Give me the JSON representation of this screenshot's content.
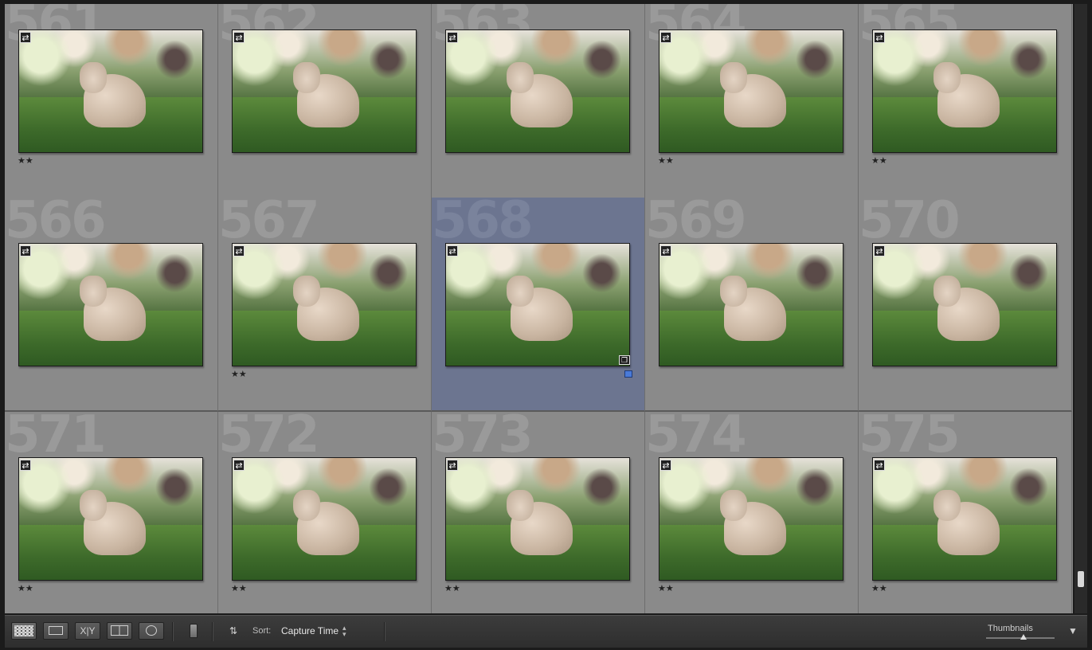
{
  "grid": {
    "cells": [
      {
        "index": "561",
        "rating": "★★",
        "selected": false
      },
      {
        "index": "562",
        "rating": "",
        "selected": false
      },
      {
        "index": "563",
        "rating": "",
        "selected": false
      },
      {
        "index": "564",
        "rating": "★★",
        "selected": false
      },
      {
        "index": "565",
        "rating": "★★",
        "selected": false
      },
      {
        "index": "566",
        "rating": "",
        "selected": false
      },
      {
        "index": "567",
        "rating": "★★",
        "selected": false
      },
      {
        "index": "568",
        "rating": "",
        "selected": true
      },
      {
        "index": "569",
        "rating": "",
        "selected": false
      },
      {
        "index": "570",
        "rating": "",
        "selected": false
      },
      {
        "index": "571",
        "rating": "★★",
        "selected": false
      },
      {
        "index": "572",
        "rating": "★★",
        "selected": false
      },
      {
        "index": "573",
        "rating": "★★",
        "selected": false
      },
      {
        "index": "574",
        "rating": "★★",
        "selected": false
      },
      {
        "index": "575",
        "rating": "★★",
        "selected": false
      }
    ],
    "badge_icon": "sync-settings-icon",
    "stack_icon": "virtual-copy-icon",
    "selected_color_label": "#4a7ad8"
  },
  "toolbar": {
    "grid_view_icon": "grid-view-icon",
    "loupe_view_icon": "loupe-view-icon",
    "compare_label": "X|Y",
    "survey_view_icon": "survey-view-icon",
    "people_view_icon": "people-view-icon",
    "spray_can_icon": "painter-icon",
    "sort_direction_icon": "sort-direction-icon",
    "sort_label": "Sort:",
    "sort_value": "Capture Time",
    "thumbnails_label": "Thumbnails",
    "thumbnail_size": 0.55,
    "menu_icon": "toolbar-menu-icon"
  }
}
